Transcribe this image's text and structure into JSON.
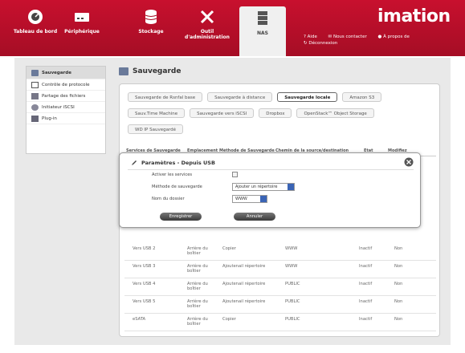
{
  "nav": {
    "items": [
      {
        "label": "Tableau de bord"
      },
      {
        "label": "Périphérique"
      },
      {
        "label": "Stockage"
      },
      {
        "label": "Outil d'administration"
      },
      {
        "label": "NAS"
      }
    ],
    "brand": "imation",
    "links": {
      "aide": "Aide",
      "contact": "Nous contacter",
      "about": "À propos de",
      "deconnexion": "Déconnexion"
    }
  },
  "sidebar": {
    "items": [
      {
        "label": "Sauvegarde"
      },
      {
        "label": "Contrôle de protocole"
      },
      {
        "label": "Partage des fichiers"
      },
      {
        "label": "Initiateur iSCSI"
      },
      {
        "label": "Plug-in"
      }
    ]
  },
  "main": {
    "title": "Sauvegarde",
    "tabs_row1": [
      "Sauvegarde de Rsnfal base",
      "Sauvegarde à distance",
      "Sauvegarde locale",
      "Amazon S3"
    ],
    "tabs_row2": [
      "Sauv.Time Machine",
      "Sauvegarde vers iSCSI",
      "Dropbox",
      "OpenStack™ Object Storage"
    ],
    "tabs_row3": [
      "WD IP Sauvegardé"
    ],
    "columns": [
      "Services de Sauvegarde",
      "Emplacement",
      "Méthode de Sauvegarde",
      "Chemin de la source/destination",
      "Etat",
      "Modifiez"
    ],
    "rows": [
      {
        "service": "Vers USB 2",
        "place": "Arrière du boîtier",
        "method": "Copier",
        "path": "WWW",
        "state": "Inactif",
        "mod": "Non"
      },
      {
        "service": "Vers USB 3",
        "place": "Arrière du boîtier",
        "method": "Ajoutenail répertoire",
        "path": "WWW",
        "state": "Inactif",
        "mod": "Non"
      },
      {
        "service": "Vers USB 4",
        "place": "Arrière du boîtier",
        "method": "Ajoutenail répertoire",
        "path": "PUBLIC",
        "state": "Inactif",
        "mod": "Non"
      },
      {
        "service": "Vers USB 5",
        "place": "Arrière du boîtier",
        "method": "Ajoutenail répertoire",
        "path": "PUBLIC",
        "state": "Inactif",
        "mod": "Non"
      },
      {
        "service": "eSATA",
        "place": "Arrière du boîtier",
        "method": "Copier",
        "path": "PUBLIC",
        "state": "Inactif",
        "mod": "Non"
      }
    ]
  },
  "dialog": {
    "title": "Paramètres - Depuis USB",
    "enable_label": "Activer les services",
    "method_label": "Méthode de sauvegarde",
    "method_value": "Ajouter un répertoire",
    "folder_label": "Nom du dossier",
    "folder_value": "WWW",
    "save_label": "Enregistrer",
    "cancel_label": "Annuler"
  }
}
